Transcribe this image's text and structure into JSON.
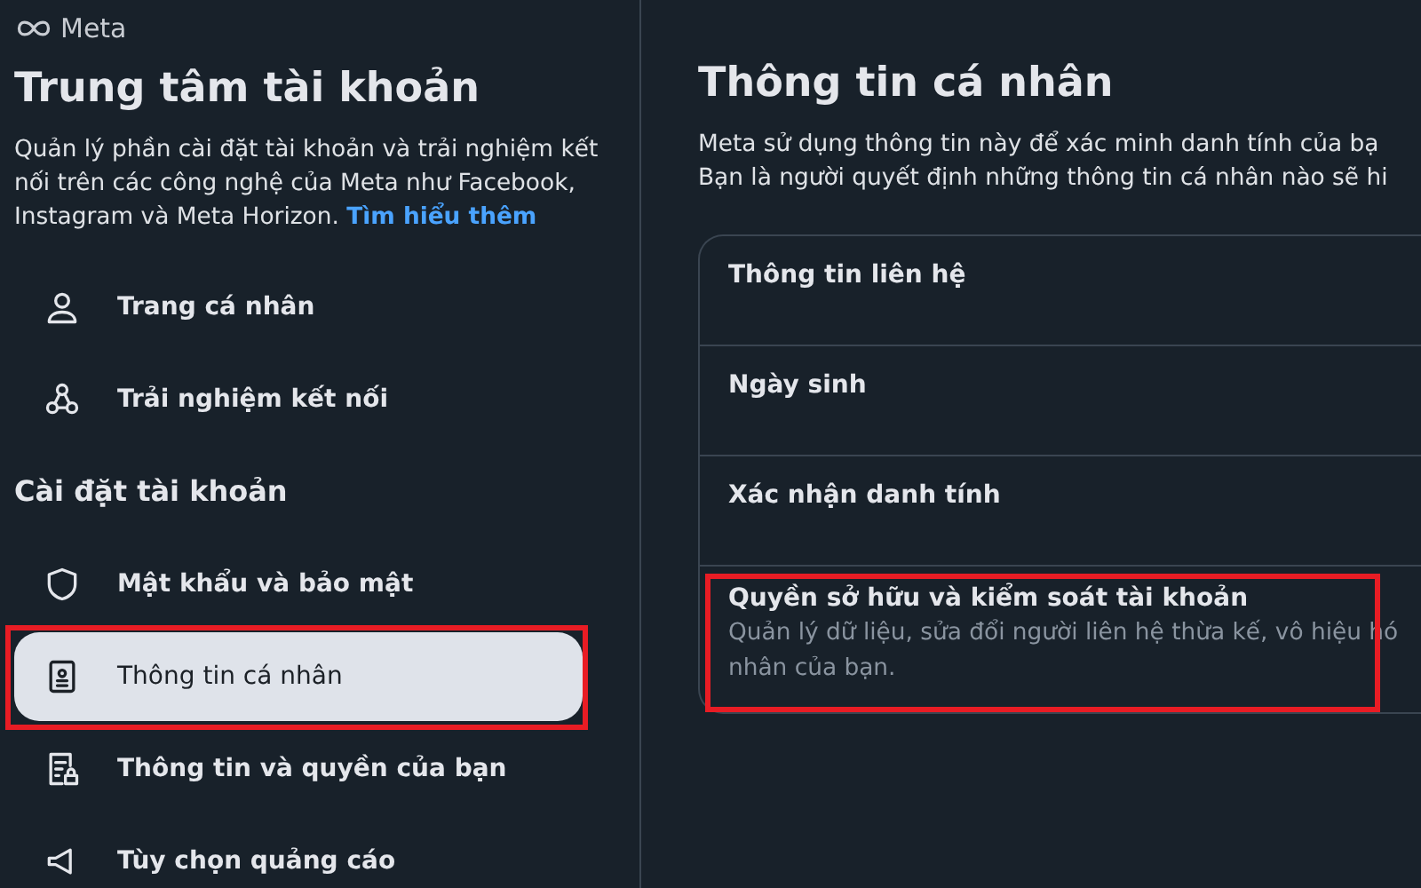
{
  "logo": {
    "text": "Meta"
  },
  "sidebar": {
    "title": "Trung tâm tài khoản",
    "description": "Quản lý phần cài đặt tài khoản và trải nghiệm kết nối trên các công nghệ của Meta như Facebook, Instagram và Meta Horizon.",
    "link": "Tìm hiểu thêm",
    "items": [
      {
        "kind": "item",
        "label": "Trang cá nhân",
        "selected": false,
        "highlighted": false
      },
      {
        "kind": "item",
        "label": "Trải nghiệm kết nối",
        "selected": false,
        "highlighted": false
      },
      {
        "kind": "heading",
        "label": "Cài đặt tài khoản"
      },
      {
        "kind": "item",
        "label": "Mật khẩu và bảo mật",
        "selected": false,
        "highlighted": false
      },
      {
        "kind": "item",
        "label": "Thông tin cá nhân",
        "selected": true,
        "highlighted": true
      },
      {
        "kind": "item",
        "label": "Thông tin và quyền của bạn",
        "selected": false,
        "highlighted": false
      },
      {
        "kind": "item",
        "label": "Tùy chọn quảng cáo",
        "selected": false,
        "highlighted": false
      }
    ]
  },
  "main": {
    "title": "Thông tin cá nhân",
    "description_lines": [
      "Meta sử dụng thông tin này để xác minh danh tính của bạ",
      "Bạn là người quyết định những thông tin cá nhân nào sẽ hi"
    ],
    "rows": [
      {
        "label": "Thông tin liên hệ",
        "highlighted": false
      },
      {
        "label": "Ngày sinh",
        "highlighted": false
      },
      {
        "label": "Xác nhận danh tính",
        "highlighted": false
      },
      {
        "label": "Quyền sở hữu và kiểm soát tài khoản",
        "description_lines": [
          "Quản lý dữ liệu, sửa đổi người liên hệ thừa kế, vô hiệu hó",
          "nhân của bạn."
        ],
        "highlighted": true
      }
    ]
  }
}
